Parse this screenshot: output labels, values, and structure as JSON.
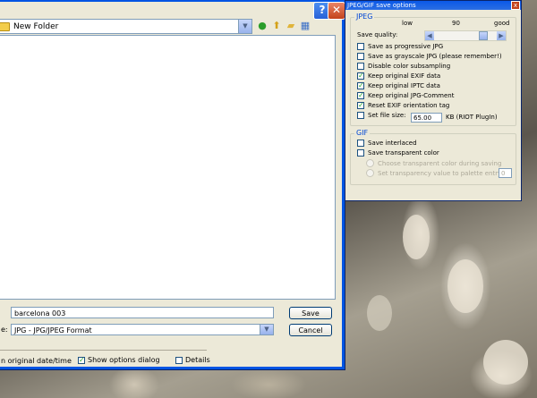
{
  "save_dialog": {
    "help_label": "?",
    "close_label": "✕",
    "lookin_value": "New Folder",
    "filename_label": "",
    "filename_value": "barcelona 003",
    "filetype_label": "e:",
    "filetype_value": "JPG - JPG/JPEG Format",
    "save_button": "Save",
    "cancel_button": "Cancel",
    "keep_date_label": "n original date/time",
    "show_options_label": "Show options dialog",
    "show_options_checked": true,
    "details_label": "Details",
    "details_checked": false
  },
  "options_dialog": {
    "title": "JPEG/GIF save options",
    "close_label": "x",
    "jpeg_group": "JPEG",
    "quality": {
      "low_label": "low",
      "value_label": "90",
      "good_label": "good",
      "label": "Save quality:",
      "level": 0.9
    },
    "jpeg_options": [
      {
        "label": "Save as progressive JPG",
        "checked": false
      },
      {
        "label": "Save as grayscale JPG (please remember!)",
        "checked": false
      },
      {
        "label": "Disable color subsampling",
        "checked": false
      },
      {
        "label": "Keep original EXIF data",
        "checked": true
      },
      {
        "label": "Keep original IPTC data",
        "checked": true
      },
      {
        "label": "Keep original JPG-Comment",
        "checked": true
      },
      {
        "label": "Reset EXIF orientation tag",
        "checked": true
      },
      {
        "label": "Set file size:",
        "checked": false
      }
    ],
    "file_size_value": "65.00",
    "file_size_unit": "KB (RIOT PlugIn)",
    "gif_group": "GIF",
    "gif_options": [
      {
        "label": "Save interlaced",
        "checked": false
      },
      {
        "label": "Save transparent color",
        "checked": false
      }
    ],
    "gif_radio": [
      {
        "label": "Choose transparent color during saving"
      },
      {
        "label": "Set transparency value to palette entry:"
      }
    ],
    "palette_entry_value": "0"
  }
}
